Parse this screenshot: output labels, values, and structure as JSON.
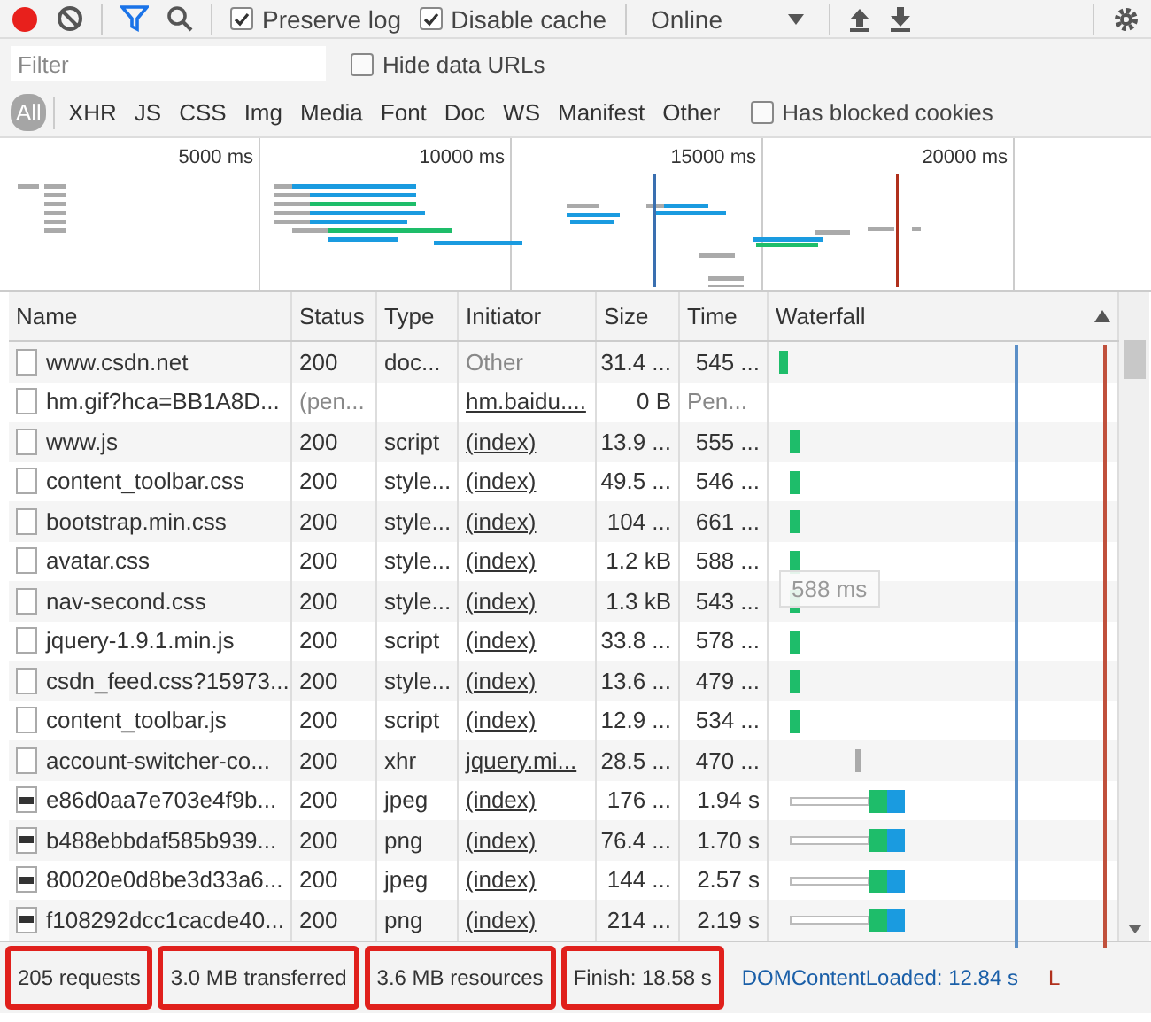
{
  "toolbar": {
    "recording": true,
    "filter_active": true,
    "checkboxes": [
      {
        "label": "Preserve log",
        "checked": true
      },
      {
        "label": "Disable cache",
        "checked": true
      }
    ],
    "throttle": "Online"
  },
  "filter_bar": {
    "placeholder": "Filter",
    "hide_data_urls": {
      "label": "Hide data URLs",
      "checked": false
    }
  },
  "type_filters": [
    {
      "label": "All",
      "selected": true
    },
    {
      "label": "XHR",
      "selected": false
    },
    {
      "label": "JS",
      "selected": false
    },
    {
      "label": "CSS",
      "selected": false
    },
    {
      "label": "Img",
      "selected": false
    },
    {
      "label": "Media",
      "selected": false
    },
    {
      "label": "Font",
      "selected": false
    },
    {
      "label": "Doc",
      "selected": false
    },
    {
      "label": "WS",
      "selected": false
    },
    {
      "label": "Manifest",
      "selected": false
    },
    {
      "label": "Other",
      "selected": false
    }
  ],
  "blocked_cookies": {
    "label": "Has blocked cookies",
    "checked": false
  },
  "overview": {
    "ticks": [
      "5000 ms",
      "10000 ms",
      "15000 ms",
      "20000 ms"
    ]
  },
  "table": {
    "columns": [
      "Name",
      "Status",
      "Type",
      "Initiator",
      "Size",
      "Time",
      "Waterfall"
    ],
    "rows": [
      {
        "name": "www.csdn.net",
        "status": "200",
        "type": "doc...",
        "initiator": "Other",
        "initiator_link": false,
        "size": "31.4 ...",
        "time": "545 ...",
        "pending": false,
        "kind": "doc"
      },
      {
        "name": "hm.gif?hca=BB1A8D...",
        "status": "(pen...",
        "type": "",
        "initiator": "hm.baidu....",
        "initiator_link": true,
        "size": "0 B",
        "time": "Pen...",
        "pending": true,
        "kind": "pending"
      },
      {
        "name": "www.js",
        "status": "200",
        "type": "script",
        "initiator": "(index)",
        "initiator_link": true,
        "size": "13.9 ...",
        "time": "555 ...",
        "pending": false,
        "kind": "resource"
      },
      {
        "name": "content_toolbar.css",
        "status": "200",
        "type": "style...",
        "initiator": "(index)",
        "initiator_link": true,
        "size": "49.5 ...",
        "time": "546 ...",
        "pending": false,
        "kind": "resource"
      },
      {
        "name": "bootstrap.min.css",
        "status": "200",
        "type": "style...",
        "initiator": "(index)",
        "initiator_link": true,
        "size": "104 ...",
        "time": "661 ...",
        "pending": false,
        "kind": "resource"
      },
      {
        "name": "avatar.css",
        "status": "200",
        "type": "style...",
        "initiator": "(index)",
        "initiator_link": true,
        "size": "1.2 kB",
        "time": "588 ...",
        "pending": false,
        "kind": "resource"
      },
      {
        "name": "nav-second.css",
        "status": "200",
        "type": "style...",
        "initiator": "(index)",
        "initiator_link": true,
        "size": "1.3 kB",
        "time": "543 ...",
        "pending": false,
        "kind": "resource"
      },
      {
        "name": "jquery-1.9.1.min.js",
        "status": "200",
        "type": "script",
        "initiator": "(index)",
        "initiator_link": true,
        "size": "33.8 ...",
        "time": "578 ...",
        "pending": false,
        "kind": "resource"
      },
      {
        "name": "csdn_feed.css?15973...",
        "status": "200",
        "type": "style...",
        "initiator": "(index)",
        "initiator_link": true,
        "size": "13.6 ...",
        "time": "479 ...",
        "pending": false,
        "kind": "resource"
      },
      {
        "name": "content_toolbar.js",
        "status": "200",
        "type": "script",
        "initiator": "(index)",
        "initiator_link": true,
        "size": "12.9 ...",
        "time": "534 ...",
        "pending": false,
        "kind": "resource"
      },
      {
        "name": "account-switcher-co...",
        "status": "200",
        "type": "xhr",
        "initiator": "jquery.mi...",
        "initiator_link": true,
        "size": "28.5 ...",
        "time": "470 ...",
        "pending": false,
        "kind": "xhr"
      },
      {
        "name": "e86d0aa7e703e4f9b...",
        "status": "200",
        "type": "jpeg",
        "initiator": "(index)",
        "initiator_link": true,
        "size": "176 ...",
        "time": "1.94 s",
        "pending": false,
        "kind": "image"
      },
      {
        "name": "b488ebbdaf585b939...",
        "status": "200",
        "type": "png",
        "initiator": "(index)",
        "initiator_link": true,
        "size": "76.4 ...",
        "time": "1.70 s",
        "pending": false,
        "kind": "image"
      },
      {
        "name": "80020e0d8be3d33a6...",
        "status": "200",
        "type": "jpeg",
        "initiator": "(index)",
        "initiator_link": true,
        "size": "144 ...",
        "time": "2.57 s",
        "pending": false,
        "kind": "image"
      },
      {
        "name": "f108292dcc1cacde40...",
        "status": "200",
        "type": "png",
        "initiator": "(index)",
        "initiator_link": true,
        "size": "214 ...",
        "time": "2.19 s",
        "pending": false,
        "kind": "image"
      }
    ],
    "tooltip": "588 ms"
  },
  "status_bar": [
    {
      "text": "205 requests",
      "kind": "plain",
      "highlighted": true
    },
    {
      "text": "3.0 MB transferred",
      "kind": "plain",
      "highlighted": true
    },
    {
      "text": "3.6 MB resources",
      "kind": "plain",
      "highlighted": true
    },
    {
      "text": "Finish: 18.58 s",
      "kind": "plain",
      "highlighted": true
    },
    {
      "text": "DOMContentLoaded: 12.84 s",
      "kind": "dcl",
      "highlighted": false
    },
    {
      "text": "L",
      "kind": "load",
      "highlighted": false
    }
  ]
}
